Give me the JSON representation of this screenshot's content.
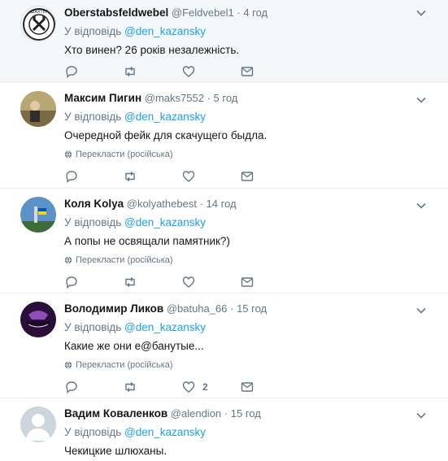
{
  "tweets": [
    {
      "name": "Oberstabsfeldwebel",
      "handle": "@Feldvebel1",
      "sep": "·",
      "time": "4 год",
      "reply_prefix": "У відповідь ",
      "reply_to": "@den_kazansky",
      "text": "Хто винен?  26 років незалежність.",
      "translate": "",
      "likes": "",
      "avatar_color": "#ffffff",
      "highlighted": true
    },
    {
      "name": "Максим Пигин",
      "handle": "@maks7552",
      "sep": "·",
      "time": "5 год",
      "reply_prefix": "У відповідь ",
      "reply_to": "@den_kazansky",
      "text": "Очередной фейк для скачущего быдла.",
      "translate": "Перекласти (російська)",
      "likes": "",
      "avatar_color": "#8a7a52",
      "highlighted": false
    },
    {
      "name": "Коля Kolya",
      "handle": "@kolyathebest",
      "sep": "·",
      "time": "14 год",
      "reply_prefix": "У відповідь ",
      "reply_to": "@den_kazansky",
      "text": "А попы не освящали памятник?)",
      "translate": "Перекласти (російська)",
      "likes": "",
      "avatar_color": "#4a7fb5",
      "highlighted": false
    },
    {
      "name": "Володимир Ликов",
      "handle": "@batuha_66",
      "sep": "·",
      "time": "15 год",
      "reply_prefix": "У відповідь ",
      "reply_to": "@den_kazansky",
      "text": "Какие же они е@банутые...",
      "translate": "Перекласти (російська)",
      "likes": "2",
      "avatar_color": "#3b1d4d",
      "highlighted": false
    },
    {
      "name": "Вадим Коваленков",
      "handle": "@alendion",
      "sep": "·",
      "time": "15 год",
      "reply_prefix": "У відповідь ",
      "reply_to": "@den_kazansky",
      "text": "Чекицкие шлюханы.",
      "translate": "",
      "likes": "",
      "avatar_color": "#ccd6dd",
      "highlighted": false
    }
  ],
  "colors": {
    "link": "#1da1f2",
    "muted": "#657786",
    "divider": "#e6ecf0"
  },
  "icons": [
    "reply-icon",
    "retweet-icon",
    "like-icon",
    "direct-message-icon",
    "chevron-down-icon",
    "globe-icon"
  ]
}
